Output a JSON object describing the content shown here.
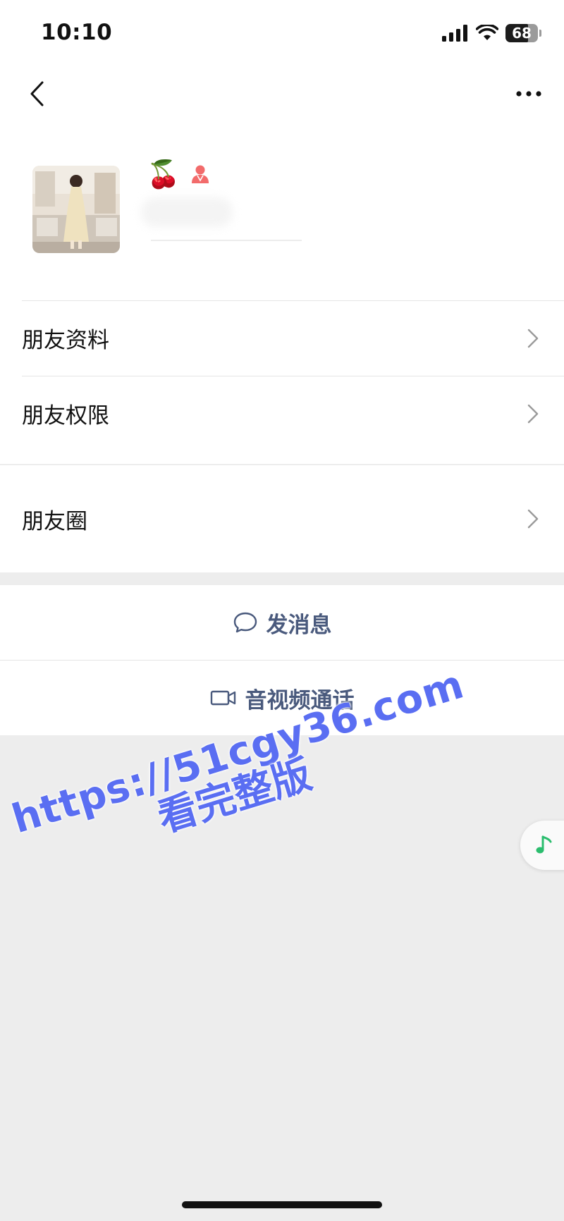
{
  "status_bar": {
    "time": "10:10",
    "battery": "68"
  },
  "nav": {
    "back_icon": "chevron-left-icon",
    "more_icon": "more-horizontal-icon"
  },
  "profile": {
    "emoji": "🍒",
    "gender_icon": "female-user-icon",
    "accent": "#f26b6b"
  },
  "menu_group_1": [
    {
      "label": "朋友资料"
    },
    {
      "label": "朋友权限"
    }
  ],
  "menu_group_2": [
    {
      "label": "朋友圈"
    }
  ],
  "actions": {
    "message_label": "发消息",
    "call_label": "音视频通话"
  },
  "watermark": {
    "line1": "https://51cgy36.com",
    "line2": "看完整版",
    "color": "#5a6ef2"
  },
  "colors": {
    "action_text": "#4a5a7d",
    "music_accent": "#2bbd6e",
    "background": "#ededed"
  }
}
